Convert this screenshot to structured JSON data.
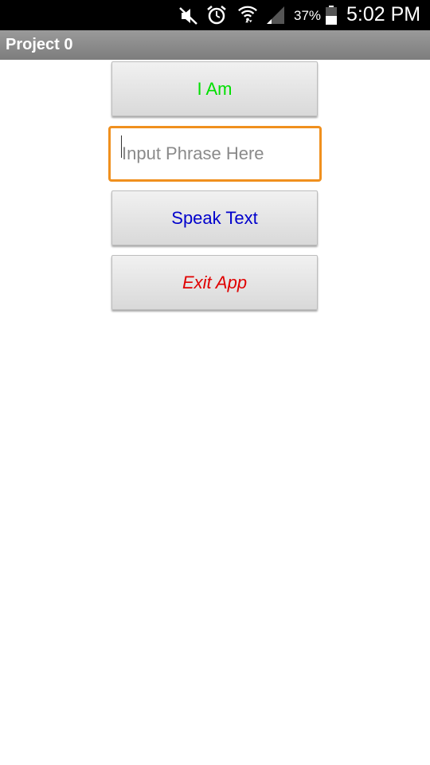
{
  "status_bar": {
    "battery_percent": "37%",
    "time": "5:02 PM",
    "icons": [
      "mute-icon",
      "alarm-icon",
      "wifi-icon",
      "signal-icon",
      "battery-icon"
    ]
  },
  "title_bar": {
    "title": "Project 0"
  },
  "main": {
    "i_am_button": {
      "label": "I Am",
      "color": "#00e000"
    },
    "phrase_input": {
      "placeholder": "Input Phrase Here",
      "value": "",
      "border_color": "#f0901e"
    },
    "speak_button": {
      "label": "Speak Text",
      "color": "#0000cc"
    },
    "exit_button": {
      "label": "Exit App",
      "color": "#e00000"
    }
  }
}
